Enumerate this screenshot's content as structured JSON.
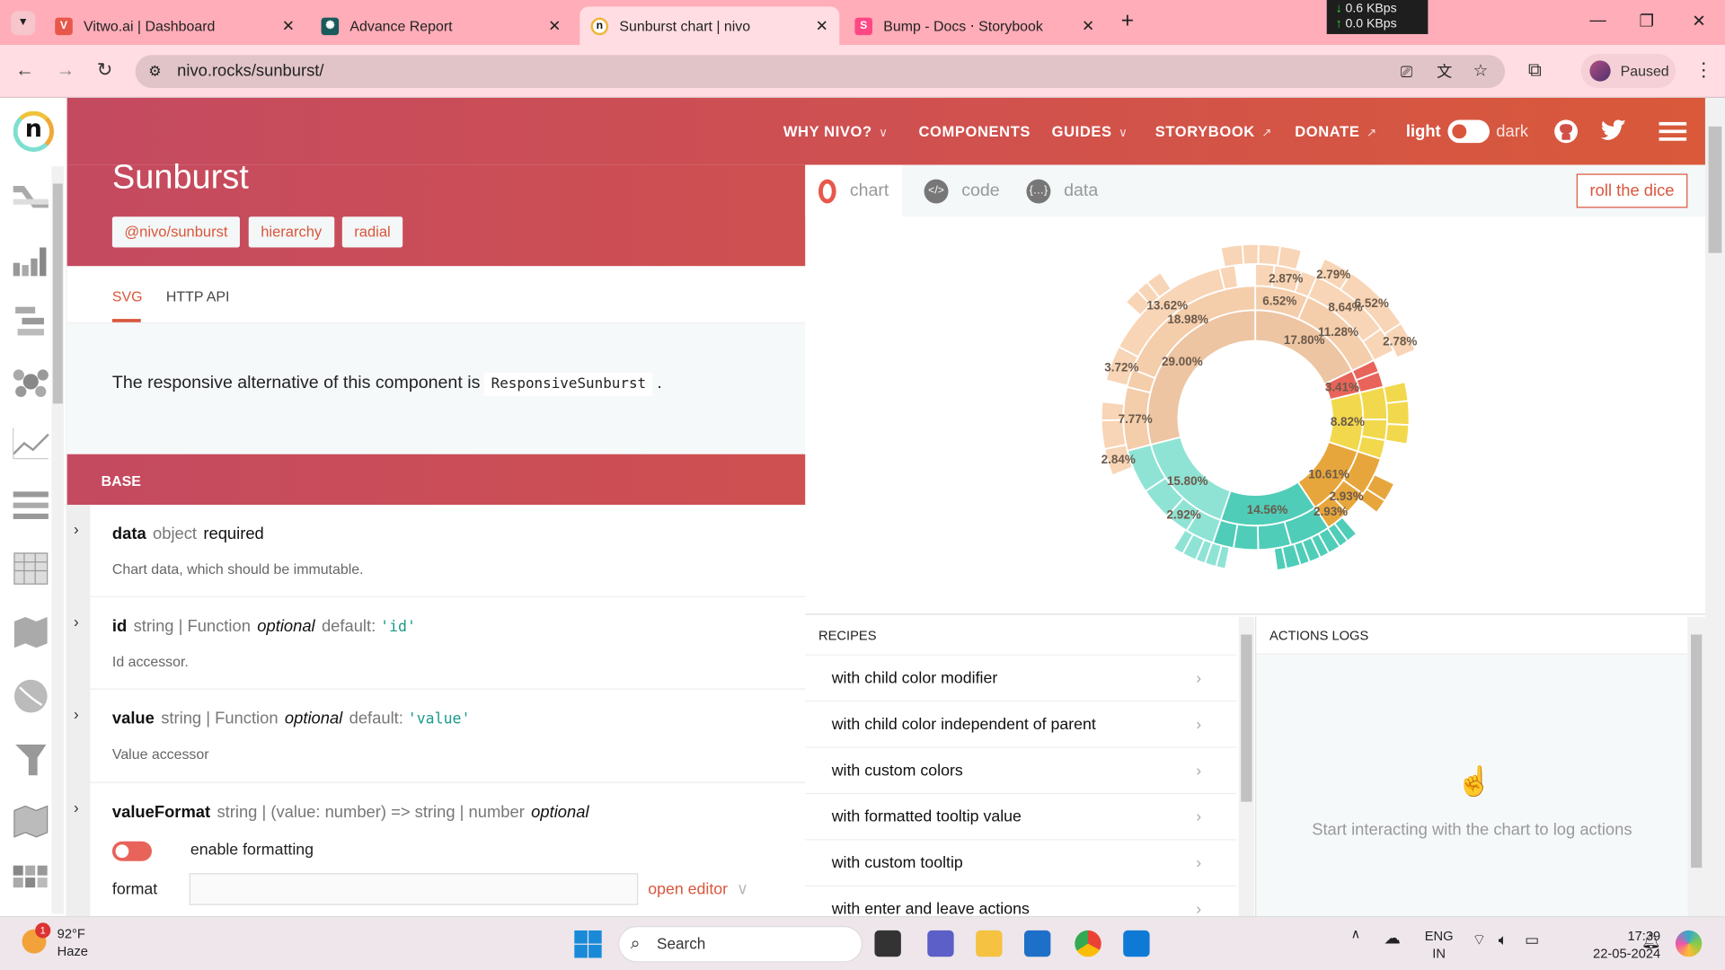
{
  "browser": {
    "tabs": [
      {
        "title": "Vitwo.ai | Dashboard",
        "favicon": "vitwo-icon",
        "color": "#e8584a",
        "active": false
      },
      {
        "title": "Advance Report",
        "favicon": "report-icon",
        "color": "#1a5a5a",
        "active": false
      },
      {
        "title": "Sunburst chart | nivo",
        "favicon": "nivo-icon",
        "color": "#f0b43a",
        "active": true
      },
      {
        "title": "Bump - Docs ⋅ Storybook",
        "favicon": "storybook-icon",
        "color": "#ff4785",
        "active": false
      }
    ],
    "network": {
      "down": "0.6 KBps",
      "up": "0.0 KBps"
    },
    "url": "nivo.rocks/sunburst/",
    "profile_label": "Paused"
  },
  "nav": {
    "links": [
      {
        "label": "WHY NIVO?",
        "dropdown": true
      },
      {
        "label": "COMPONENTS"
      },
      {
        "label": "GUIDES",
        "dropdown": true
      },
      {
        "label": "STORYBOOK",
        "external": true
      },
      {
        "label": "DONATE",
        "external": true
      }
    ],
    "theme_light": "light",
    "theme_dark": "dark",
    "theme_is_dark": false
  },
  "page": {
    "title": "Sunburst",
    "tags": [
      "@nivo/sunburst",
      "hierarchy",
      "radial"
    ],
    "subtabs": [
      "SVG",
      "HTTP API"
    ],
    "active_subtab": "SVG",
    "description_prefix": "The responsive alternative of this component is",
    "description_code": "ResponsiveSunburst",
    "description_suffix": ".",
    "section": "BASE",
    "props": [
      {
        "name": "data",
        "type": "object",
        "required": "required",
        "desc": "Chart data, which should be immutable."
      },
      {
        "name": "id",
        "type": "string | Function",
        "optional": "optional",
        "default_label": "default:",
        "default": "'id'",
        "desc": "Id accessor."
      },
      {
        "name": "value",
        "type": "string | Function",
        "optional": "optional",
        "default_label": "default:",
        "default": "'value'",
        "desc": "Value accessor"
      },
      {
        "name": "valueFormat",
        "type": "string | (value: number) => string | number",
        "optional": "optional"
      }
    ],
    "enable_formatting_label": "enable formatting",
    "enable_formatting": true,
    "format_label": "format",
    "format_value": "",
    "open_editor_label": "open editor"
  },
  "chart_panel": {
    "tabs": [
      "chart",
      "code",
      "data"
    ],
    "active_tab": "chart",
    "roll_label": "roll the dice"
  },
  "chart_data": {
    "type": "sunburst",
    "unit": "%",
    "colors": {
      "beige1": "#edc5a3",
      "beige2": "#f4cdab",
      "beige3": "#f8d5b6",
      "red": "#e8645a",
      "yellow": "#f2d84c",
      "orange": "#e7a63c",
      "teal": "#4fcdb8",
      "lightteal": "#8fe3d5"
    },
    "rings": [
      [
        {
          "value": 17.8,
          "color": "beige1",
          "label": "17.80%"
        },
        {
          "value": 3.41,
          "color": "red",
          "label": "3.41%"
        },
        {
          "value": 8.82,
          "color": "yellow",
          "label": "8.82%"
        },
        {
          "value": 10.61,
          "color": "orange",
          "label": "10.61%"
        },
        {
          "value": 14.56,
          "color": "teal",
          "label": "14.56%"
        },
        {
          "value": 15.8,
          "color": "lightteal",
          "label": "15.80%"
        },
        {
          "value": 29.0,
          "color": "beige1",
          "label": "29.00%"
        }
      ],
      [
        {
          "value": 6.52,
          "color": "beige2",
          "label": "6.52%"
        },
        {
          "value": 11.28,
          "color": "beige2",
          "label": "11.28%"
        },
        {
          "value": 1.5,
          "color": "red"
        },
        {
          "value": 1.91,
          "color": "red"
        },
        {
          "value": 4.0,
          "color": "yellow"
        },
        {
          "value": 2.5,
          "color": "yellow"
        },
        {
          "value": 2.32,
          "color": "yellow"
        },
        {
          "value": 4.75,
          "color": "orange"
        },
        {
          "value": 2.93,
          "color": "orange",
          "label": "2.93%"
        },
        {
          "value": 2.93,
          "color": "orange",
          "label": "2.93%"
        },
        {
          "value": 5.0,
          "color": "teal"
        },
        {
          "value": 4.0,
          "color": "teal"
        },
        {
          "value": 3.0,
          "color": "teal"
        },
        {
          "value": 2.56,
          "color": "teal"
        },
        {
          "value": 3.5,
          "color": "lightteal"
        },
        {
          "value": 2.92,
          "color": "lightteal",
          "label": "2.92%"
        },
        {
          "value": 4.0,
          "color": "lightteal"
        },
        {
          "value": 5.38,
          "color": "lightteal"
        },
        {
          "value": 7.77,
          "color": "beige2",
          "label": "7.77%"
        },
        {
          "value": 2.25,
          "color": "beige2"
        },
        {
          "value": 18.98,
          "color": "beige2",
          "label": "18.98%"
        }
      ],
      [
        {
          "value": 2.0,
          "color": "beige3"
        },
        {
          "value": 2.87,
          "color": "beige3",
          "label": "2.87%"
        },
        {
          "value": 1.67,
          "color": "beige3"
        },
        {
          "value": 8.64,
          "color": "beige3",
          "label": "8.64%"
        },
        {
          "value": 2.64,
          "color": "beige3"
        },
        {
          "value": 3.41,
          "gap": true
        },
        {
          "value": 2.0,
          "color": "yellow"
        },
        {
          "value": 2.5,
          "color": "yellow"
        },
        {
          "value": 2.0,
          "color": "yellow"
        },
        {
          "value": 4.32,
          "gap": true
        },
        {
          "value": 2.0,
          "color": "orange"
        },
        {
          "value": 1.5,
          "color": "orange"
        },
        {
          "value": 3.0,
          "gap": true
        },
        {
          "value": 1.2,
          "color": "teal"
        },
        {
          "value": 1.0,
          "color": "teal"
        },
        {
          "value": 1.3,
          "color": "teal"
        },
        {
          "value": 1.0,
          "color": "teal"
        },
        {
          "value": 1.2,
          "color": "teal"
        },
        {
          "value": 1.0,
          "color": "teal"
        },
        {
          "value": 1.5,
          "color": "teal"
        },
        {
          "value": 1.0,
          "color": "teal"
        },
        {
          "value": 5.36,
          "gap": true
        },
        {
          "value": 1.0,
          "color": "lightteal"
        },
        {
          "value": 1.2,
          "color": "lightteal"
        },
        {
          "value": 1.0,
          "color": "lightteal"
        },
        {
          "value": 1.5,
          "color": "lightteal"
        },
        {
          "value": 1.1,
          "color": "lightteal"
        },
        {
          "value": 10.0,
          "gap": true
        },
        {
          "value": 2.84,
          "color": "beige3",
          "label": "2.84%"
        },
        {
          "value": 3.0,
          "color": "beige3"
        },
        {
          "value": 1.93,
          "color": "beige3"
        },
        {
          "value": 2.25,
          "gap": true
        },
        {
          "value": 3.72,
          "color": "beige3",
          "label": "3.72%"
        },
        {
          "value": 13.62,
          "color": "beige3",
          "label": "13.62%"
        },
        {
          "value": 1.64,
          "color": "beige3"
        }
      ],
      [
        {
          "value": 6.52,
          "gap": true
        },
        {
          "value": 2.79,
          "color": "beige3",
          "label": "2.79%"
        },
        {
          "value": 6.52,
          "color": "beige3",
          "label": "6.52%"
        },
        {
          "value": 2.78,
          "color": "beige3",
          "label": "2.78%"
        },
        {
          "value": 68.0,
          "gap": true
        },
        {
          "value": 1.5,
          "color": "beige3"
        },
        {
          "value": 1.2,
          "color": "beige3"
        },
        {
          "value": 1.5,
          "color": "beige3"
        },
        {
          "value": 6.0,
          "gap": true
        },
        {
          "value": 2.0,
          "color": "beige3"
        },
        {
          "value": 1.5,
          "color": "beige3"
        },
        {
          "value": 2.0,
          "color": "beige3"
        },
        {
          "value": 2.0,
          "color": "beige3"
        }
      ]
    ]
  },
  "recipes": {
    "title": "RECIPES",
    "items": [
      "with child color modifier",
      "with child color independent of parent",
      "with custom colors",
      "with formatted tooltip value",
      "with custom tooltip",
      "with enter and leave actions"
    ]
  },
  "actions": {
    "title": "ACTIONS LOGS",
    "empty": "Start interacting with the chart to log actions"
  },
  "taskbar": {
    "temp": "92°F",
    "weather": "Haze",
    "weather_badge": "1",
    "search_placeholder": "Search",
    "lang1": "ENG",
    "lang2": "IN",
    "time": "17:39",
    "date": "22-05-2024"
  }
}
